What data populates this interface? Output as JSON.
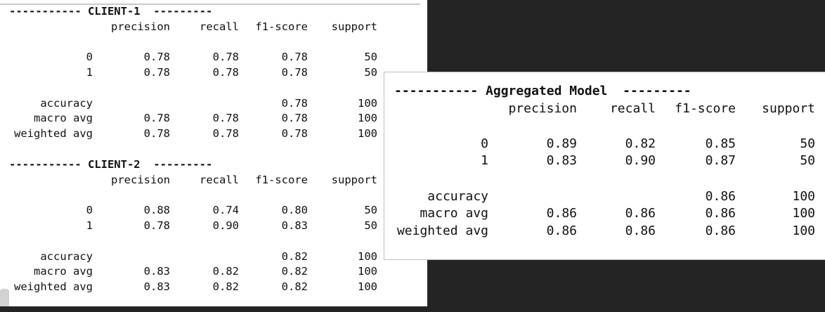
{
  "client1": {
    "title": "----------- CLIENT-1  ---------",
    "headers": [
      "precision",
      "recall",
      "f1-score",
      "support"
    ],
    "rows": [
      {
        "label": "0",
        "precision": "0.78",
        "recall": "0.78",
        "f1": "0.78",
        "support": "50"
      },
      {
        "label": "1",
        "precision": "0.78",
        "recall": "0.78",
        "f1": "0.78",
        "support": "50"
      },
      {
        "label": "accuracy",
        "precision": "",
        "recall": "",
        "f1": "0.78",
        "support": "100"
      },
      {
        "label": "macro avg",
        "precision": "0.78",
        "recall": "0.78",
        "f1": "0.78",
        "support": "100"
      },
      {
        "label": "weighted avg",
        "precision": "0.78",
        "recall": "0.78",
        "f1": "0.78",
        "support": "100"
      }
    ]
  },
  "client2": {
    "title": "----------- CLIENT-2  ---------",
    "headers": [
      "precision",
      "recall",
      "f1-score",
      "support"
    ],
    "rows": [
      {
        "label": "0",
        "precision": "0.88",
        "recall": "0.74",
        "f1": "0.80",
        "support": "50"
      },
      {
        "label": "1",
        "precision": "0.78",
        "recall": "0.90",
        "f1": "0.83",
        "support": "50"
      },
      {
        "label": "accuracy",
        "precision": "",
        "recall": "",
        "f1": "0.82",
        "support": "100"
      },
      {
        "label": "macro avg",
        "precision": "0.83",
        "recall": "0.82",
        "f1": "0.82",
        "support": "100"
      },
      {
        "label": "weighted avg",
        "precision": "0.83",
        "recall": "0.82",
        "f1": "0.82",
        "support": "100"
      }
    ]
  },
  "aggregated": {
    "title": "----------- Aggregated Model  ---------",
    "headers": [
      "precision",
      "recall",
      "f1-score",
      "support"
    ],
    "rows": [
      {
        "label": "0",
        "precision": "0.89",
        "recall": "0.82",
        "f1": "0.85",
        "support": "50"
      },
      {
        "label": "1",
        "precision": "0.83",
        "recall": "0.90",
        "f1": "0.87",
        "support": "50"
      },
      {
        "label": "accuracy",
        "precision": "",
        "recall": "",
        "f1": "0.86",
        "support": "100"
      },
      {
        "label": "macro avg",
        "precision": "0.86",
        "recall": "0.86",
        "f1": "0.86",
        "support": "100"
      },
      {
        "label": "weighted avg",
        "precision": "0.86",
        "recall": "0.86",
        "f1": "0.86",
        "support": "100"
      }
    ]
  }
}
